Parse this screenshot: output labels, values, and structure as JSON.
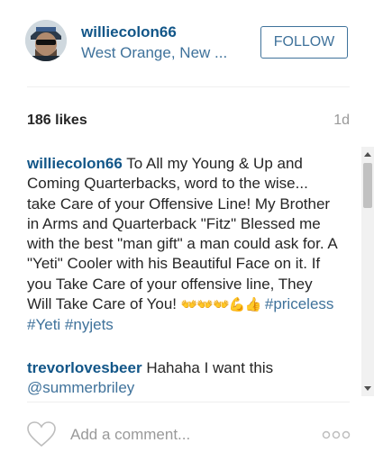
{
  "post": {
    "header": {
      "username": "williecolon66",
      "location": "West Orange, New ...",
      "follow_label": "FOLLOW"
    },
    "likes": "186 likes",
    "time_ago": "1d",
    "caption": {
      "user": "williecolon66",
      "text": "To All my Young & Up and Coming Quarterbacks, word to the wise... take Care of your Offensive Line! My Brother in Arms and Quarterback \"Fitz\" Blessed me with the best \"man gift\" a man could ask for. A \"Yeti\" Cooler with his Beautiful Face on it. If you Take Care of your offensive line, They Will Take Care of You!",
      "emoji": "👐👐👐💪👍",
      "hashtags": [
        "#priceless",
        "#Yeti",
        "#nyjets"
      ]
    },
    "comments": [
      {
        "user": "trevorlovesbeer",
        "text": "Hahaha I want this",
        "mention": "@summerbriley"
      }
    ],
    "add_comment_placeholder": "Add a comment...",
    "icons": [
      "heart-icon",
      "more-options-icon"
    ]
  },
  "colors": {
    "username": "#125688",
    "link": "#3f729b",
    "text": "#262626",
    "muted": "#999999",
    "divider": "#efefef"
  }
}
